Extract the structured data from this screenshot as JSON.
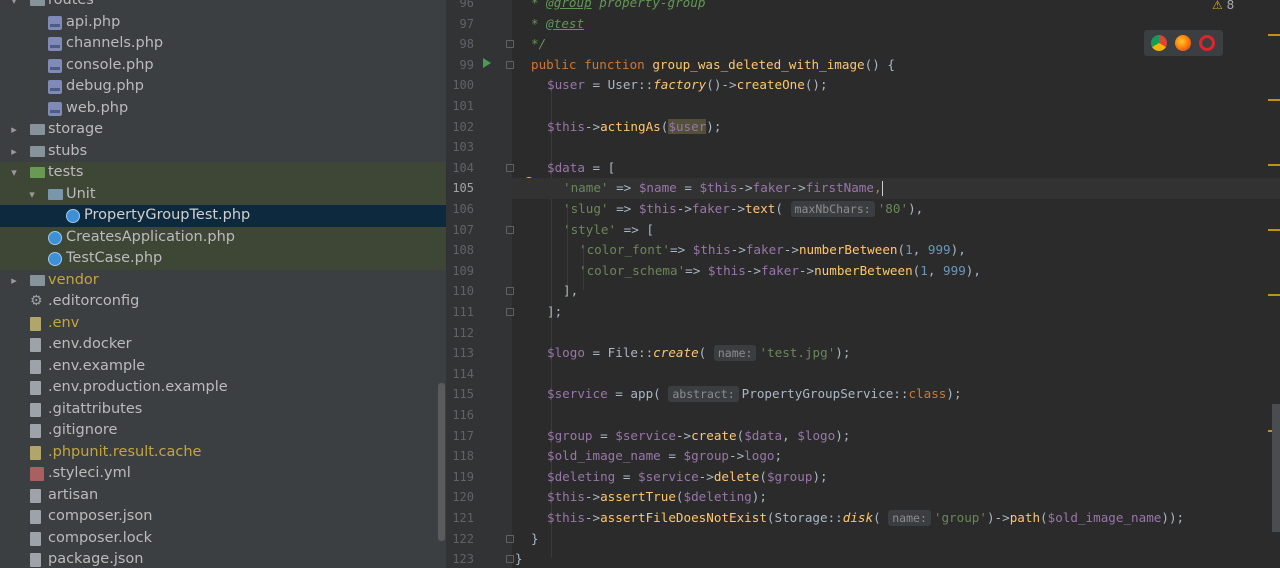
{
  "tree": [
    {
      "label": "routes",
      "type": "folder",
      "depth": 1,
      "expand": "open",
      "partial": true
    },
    {
      "label": "api.php",
      "type": "php",
      "depth": 2
    },
    {
      "label": "channels.php",
      "type": "php",
      "depth": 2
    },
    {
      "label": "console.php",
      "type": "php",
      "depth": 2
    },
    {
      "label": "debug.php",
      "type": "php",
      "depth": 2
    },
    {
      "label": "web.php",
      "type": "php",
      "depth": 2
    },
    {
      "label": "storage",
      "type": "folder",
      "depth": 1,
      "expand": "closed"
    },
    {
      "label": "stubs",
      "type": "folder",
      "depth": 1,
      "expand": "closed"
    },
    {
      "label": "tests",
      "type": "folder-green",
      "depth": 1,
      "expand": "open",
      "hl": true
    },
    {
      "label": "Unit",
      "type": "folder-lb",
      "depth": 2,
      "expand": "open",
      "hl": true
    },
    {
      "label": "PropertyGroupTest.php",
      "type": "class",
      "depth": 3,
      "sel": true
    },
    {
      "label": "CreatesApplication.php",
      "type": "class",
      "depth": 2,
      "hl": true
    },
    {
      "label": "TestCase.php",
      "type": "class",
      "depth": 2,
      "hl": true
    },
    {
      "label": "vendor",
      "type": "folder",
      "depth": 1,
      "expand": "closed",
      "yellow": true
    },
    {
      "label": ".editorconfig",
      "type": "gear",
      "depth": 1
    },
    {
      "label": ".env",
      "type": "doc-y",
      "depth": 1,
      "yellow": true
    },
    {
      "label": ".env.docker",
      "type": "doc",
      "depth": 1
    },
    {
      "label": ".env.example",
      "type": "doc",
      "depth": 1
    },
    {
      "label": ".env.production.example",
      "type": "doc",
      "depth": 1
    },
    {
      "label": ".gitattributes",
      "type": "doc",
      "depth": 1
    },
    {
      "label": ".gitignore",
      "type": "doc",
      "depth": 1
    },
    {
      "label": ".phpunit.result.cache",
      "type": "doc-y",
      "depth": 1,
      "yellow": true
    },
    {
      "label": ".styleci.yml",
      "type": "yml",
      "depth": 1
    },
    {
      "label": "artisan",
      "type": "doc",
      "depth": 1
    },
    {
      "label": "composer.json",
      "type": "doc",
      "depth": 1
    },
    {
      "label": "composer.lock",
      "type": "doc",
      "depth": 1
    },
    {
      "label": "package.json",
      "type": "doc",
      "depth": 1
    }
  ],
  "editor": {
    "warnings": "8",
    "current_line": "105",
    "lines": [
      {
        "n": "96",
        "code": [
          [
            "c",
            "* "
          ],
          [
            "ct",
            "@group"
          ],
          [
            "c",
            " property-group"
          ]
        ]
      },
      {
        "n": "97",
        "code": [
          [
            "c",
            "* "
          ],
          [
            "ct",
            "@test"
          ]
        ]
      },
      {
        "n": "98",
        "code": [
          [
            "c",
            "*/"
          ]
        ]
      },
      {
        "n": "99",
        "code": [
          [
            "k",
            "public function "
          ],
          [
            "f",
            "group_was_deleted_with_image"
          ],
          [
            "t",
            "() {"
          ]
        ]
      },
      {
        "n": "100",
        "code": [
          [
            "v",
            "$user"
          ],
          [
            "t",
            " = User::"
          ],
          [
            "sm",
            "factory"
          ],
          [
            "t",
            "()->"
          ],
          [
            "f",
            "createOne"
          ],
          [
            "t",
            "();"
          ]
        ]
      },
      {
        "n": "101",
        "code": []
      },
      {
        "n": "102",
        "code": [
          [
            "v",
            "$this"
          ],
          [
            "t",
            "->"
          ],
          [
            "f",
            "actingAs"
          ],
          [
            "t",
            "("
          ],
          [
            "vu",
            "$user"
          ],
          [
            "t",
            ");"
          ]
        ]
      },
      {
        "n": "103",
        "code": []
      },
      {
        "n": "104",
        "code": [
          [
            "v",
            "$data"
          ],
          [
            "t",
            " = ["
          ]
        ]
      },
      {
        "n": "105",
        "code": [
          [
            "s",
            "'name'"
          ],
          [
            "t",
            " => "
          ],
          [
            "v",
            "$name"
          ],
          [
            "t",
            " = "
          ],
          [
            "v",
            "$this"
          ],
          [
            "t",
            "->"
          ],
          [
            "v",
            "faker"
          ],
          [
            "t",
            "->"
          ],
          [
            "v",
            "firstName"
          ],
          [
            "k",
            ","
          ],
          [
            "caret",
            ""
          ]
        ]
      },
      {
        "n": "106",
        "code": [
          [
            "s",
            "'slug'"
          ],
          [
            "t",
            " => "
          ],
          [
            "v",
            "$this"
          ],
          [
            "t",
            "->"
          ],
          [
            "v",
            "faker"
          ],
          [
            "t",
            "->"
          ],
          [
            "f",
            "text"
          ],
          [
            "t",
            "( "
          ],
          [
            "h",
            "maxNbChars:"
          ],
          [
            "s",
            "'80'"
          ],
          [
            "t",
            "),"
          ]
        ]
      },
      {
        "n": "107",
        "code": [
          [
            "s",
            "'style'"
          ],
          [
            "t",
            " => ["
          ]
        ]
      },
      {
        "n": "108",
        "code": [
          [
            "s",
            "'color_font'"
          ],
          [
            "t",
            "=> "
          ],
          [
            "v",
            "$this"
          ],
          [
            "t",
            "->"
          ],
          [
            "v",
            "faker"
          ],
          [
            "t",
            "->"
          ],
          [
            "f",
            "numberBetween"
          ],
          [
            "t",
            "("
          ],
          [
            "n",
            "1"
          ],
          [
            "t",
            ", "
          ],
          [
            "n",
            "999"
          ],
          [
            "t",
            "),"
          ]
        ]
      },
      {
        "n": "109",
        "code": [
          [
            "s",
            "'color_schema'"
          ],
          [
            "t",
            "=> "
          ],
          [
            "v",
            "$this"
          ],
          [
            "t",
            "->"
          ],
          [
            "v",
            "faker"
          ],
          [
            "t",
            "->"
          ],
          [
            "f",
            "numberBetween"
          ],
          [
            "t",
            "("
          ],
          [
            "n",
            "1"
          ],
          [
            "t",
            ", "
          ],
          [
            "n",
            "999"
          ],
          [
            "t",
            "),"
          ]
        ]
      },
      {
        "n": "110",
        "code": [
          [
            "t",
            "],"
          ]
        ]
      },
      {
        "n": "111",
        "code": [
          [
            "t",
            "];"
          ]
        ]
      },
      {
        "n": "112",
        "code": []
      },
      {
        "n": "113",
        "code": [
          [
            "v",
            "$logo"
          ],
          [
            "t",
            " = File::"
          ],
          [
            "sm",
            "create"
          ],
          [
            "t",
            "( "
          ],
          [
            "h",
            "name:"
          ],
          [
            "s",
            "'test.jpg'"
          ],
          [
            "t",
            ");"
          ]
        ]
      },
      {
        "n": "114",
        "code": []
      },
      {
        "n": "115",
        "code": [
          [
            "v",
            "$service"
          ],
          [
            "t",
            " = app( "
          ],
          [
            "h",
            "abstract:"
          ],
          [
            "t",
            "PropertyGroupService::"
          ],
          [
            "k",
            "class"
          ],
          [
            "t",
            ");"
          ]
        ]
      },
      {
        "n": "116",
        "code": []
      },
      {
        "n": "117",
        "code": [
          [
            "v",
            "$group"
          ],
          [
            "t",
            " = "
          ],
          [
            "v",
            "$service"
          ],
          [
            "t",
            "->"
          ],
          [
            "f",
            "create"
          ],
          [
            "t",
            "("
          ],
          [
            "v",
            "$data"
          ],
          [
            "t",
            ", "
          ],
          [
            "v",
            "$logo"
          ],
          [
            "t",
            ");"
          ]
        ]
      },
      {
        "n": "118",
        "code": [
          [
            "v",
            "$old_image_name"
          ],
          [
            "t",
            " = "
          ],
          [
            "v",
            "$group"
          ],
          [
            "t",
            "->"
          ],
          [
            "v",
            "logo"
          ],
          [
            "t",
            ";"
          ]
        ]
      },
      {
        "n": "119",
        "code": [
          [
            "v",
            "$deleting"
          ],
          [
            "t",
            " = "
          ],
          [
            "v",
            "$service"
          ],
          [
            "t",
            "->"
          ],
          [
            "f",
            "delete"
          ],
          [
            "t",
            "("
          ],
          [
            "v",
            "$group"
          ],
          [
            "t",
            ");"
          ]
        ]
      },
      {
        "n": "120",
        "code": [
          [
            "v",
            "$this"
          ],
          [
            "t",
            "->"
          ],
          [
            "f",
            "assertTrue"
          ],
          [
            "t",
            "("
          ],
          [
            "v",
            "$deleting"
          ],
          [
            "t",
            ");"
          ]
        ]
      },
      {
        "n": "121",
        "code": [
          [
            "v",
            "$this"
          ],
          [
            "t",
            "->"
          ],
          [
            "f",
            "assertFileDoesNotExist"
          ],
          [
            "t",
            "(Storage::"
          ],
          [
            "sm",
            "disk"
          ],
          [
            "t",
            "( "
          ],
          [
            "h",
            "name:"
          ],
          [
            "s",
            "'group'"
          ],
          [
            "t",
            ")->"
          ],
          [
            "f",
            "path"
          ],
          [
            "t",
            "("
          ],
          [
            "v",
            "$old_image_name"
          ],
          [
            "t",
            "));"
          ]
        ]
      },
      {
        "n": "122",
        "code": [
          [
            "t",
            "}"
          ]
        ]
      },
      {
        "n": "123",
        "code": [
          [
            "t",
            "}"
          ]
        ]
      }
    ]
  },
  "colors": {
    "accent": "#cc7832",
    "string": "#6a8759",
    "variable": "#9876aa",
    "function": "#ffc66d"
  }
}
